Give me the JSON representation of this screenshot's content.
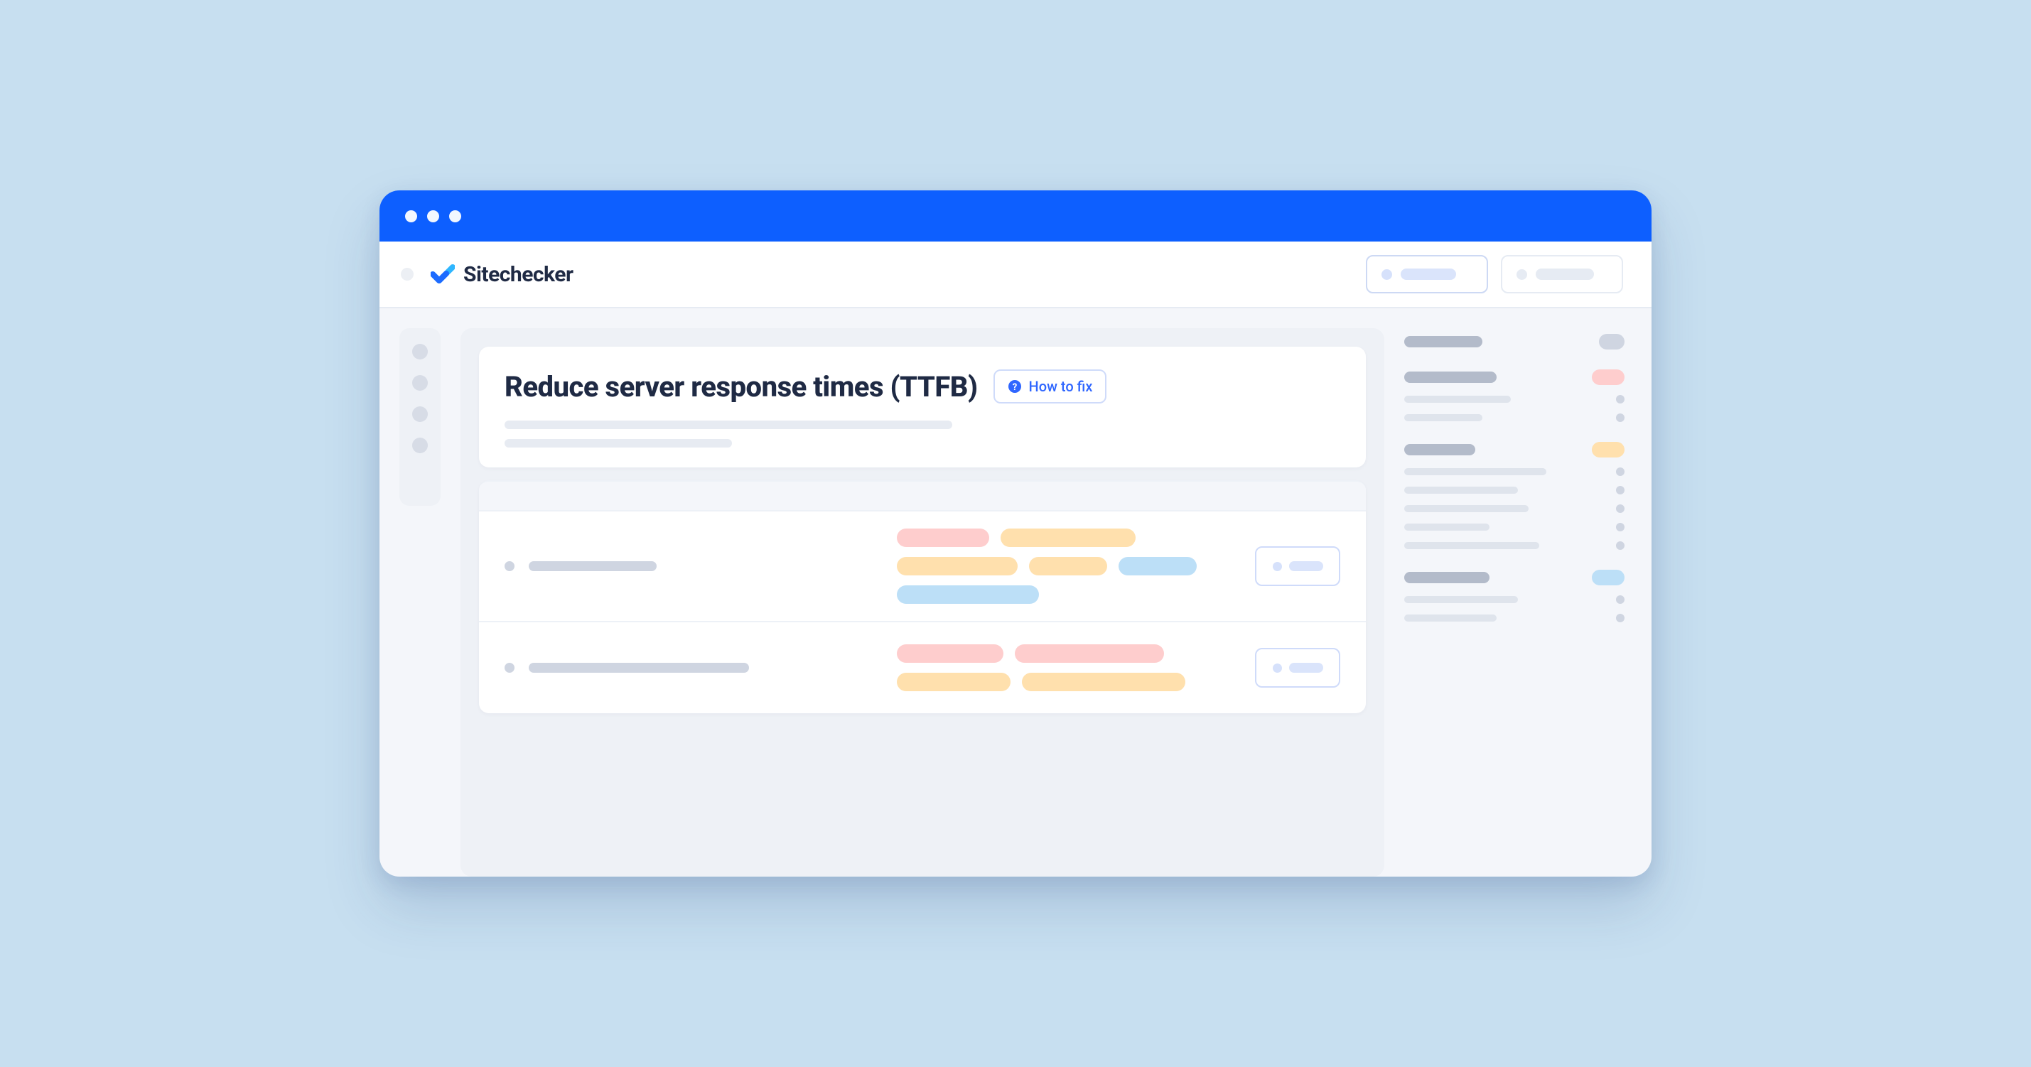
{
  "brand": {
    "name": "Sitechecker"
  },
  "page": {
    "title": "Reduce server response times (TTFB)",
    "how_to_fix_label": "How to fix"
  }
}
